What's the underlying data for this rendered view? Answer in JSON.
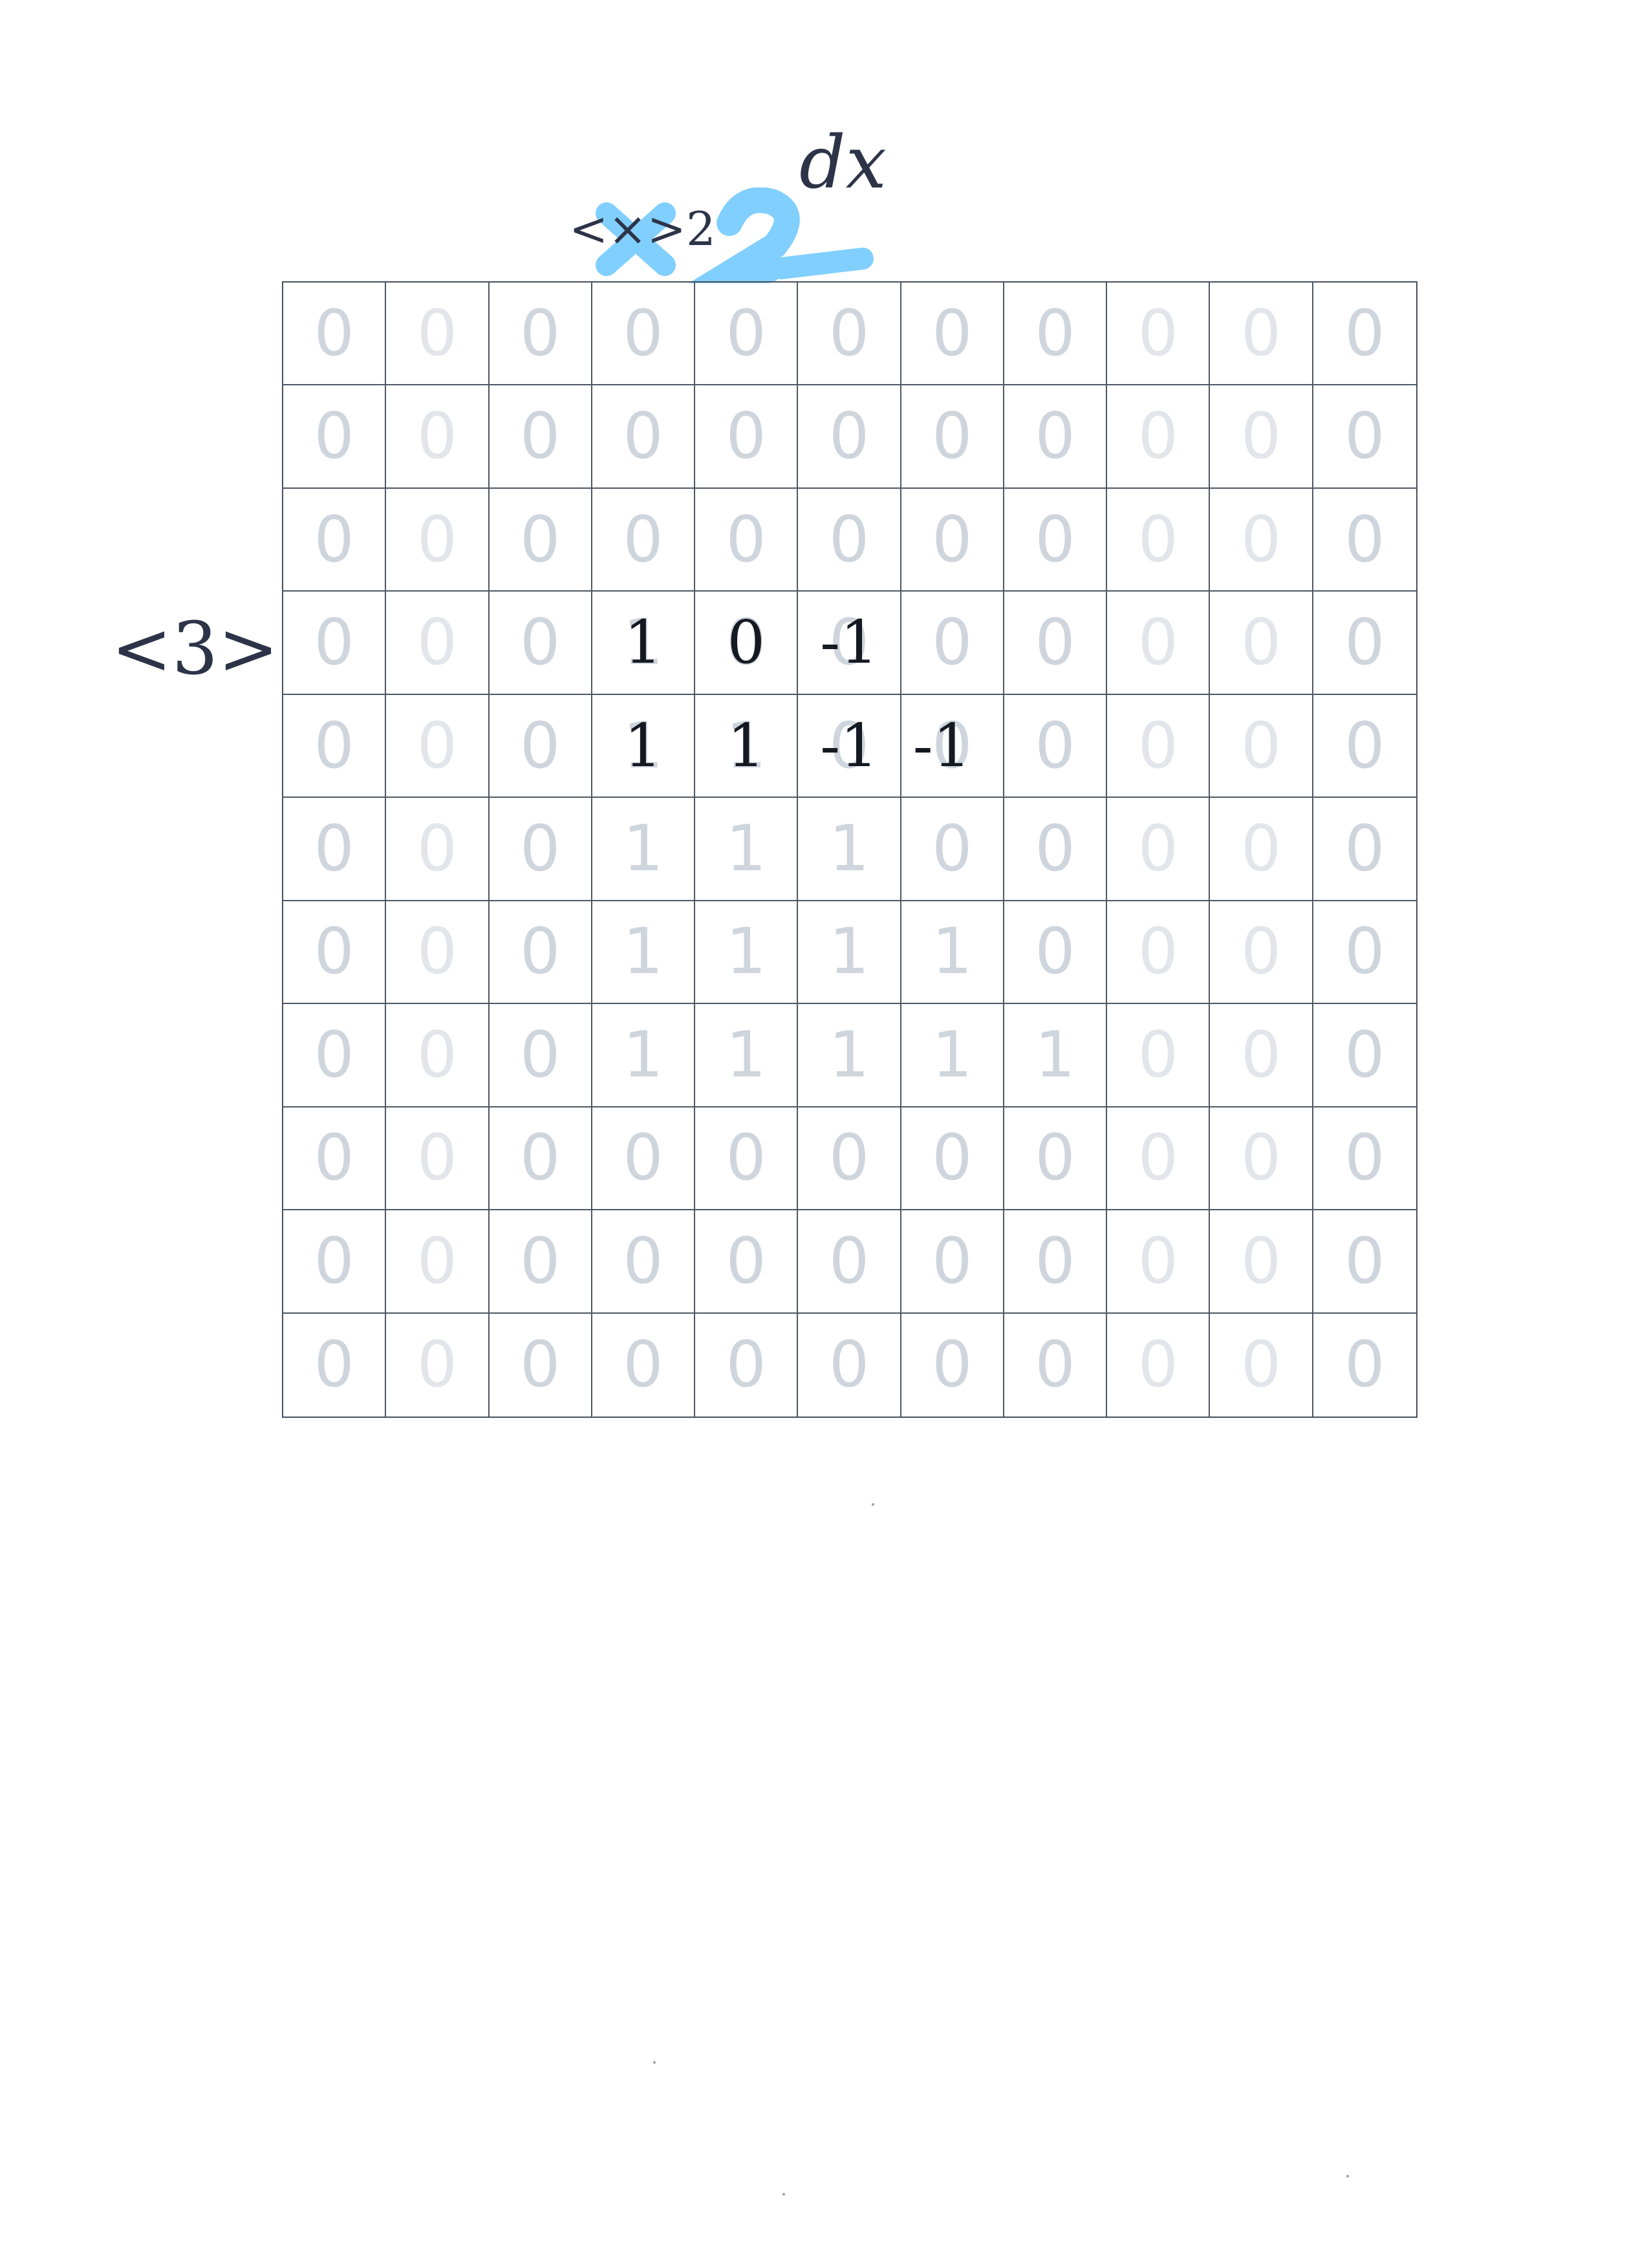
{
  "annotations": {
    "left_label": "<3>",
    "top_label": "<×>2",
    "dx_label": "dx"
  },
  "colors": {
    "grid_line": "#4d5865",
    "printed_digit": "#cfd5dc",
    "handwriting": "#151a22",
    "blue_highlight": "#80cfff",
    "pen_annotation": "#2d3448"
  },
  "grid": {
    "rows": [
      [
        "0",
        "0",
        "0",
        "0",
        "0",
        "0",
        "0",
        "0",
        "0",
        "0",
        "0"
      ],
      [
        "0",
        "0",
        "0",
        "0",
        "0",
        "0",
        "0",
        "0",
        "0",
        "0",
        "0"
      ],
      [
        "0",
        "0",
        "0",
        "0",
        "0",
        "0",
        "0",
        "0",
        "0",
        "0",
        "0"
      ],
      [
        "0",
        "0",
        "0",
        "1",
        "0",
        "0",
        "0",
        "0",
        "0",
        "0",
        "0"
      ],
      [
        "0",
        "0",
        "0",
        "1",
        "1",
        "0",
        "0",
        "0",
        "0",
        "0",
        "0"
      ],
      [
        "0",
        "0",
        "0",
        "1",
        "1",
        "1",
        "0",
        "0",
        "0",
        "0",
        "0"
      ],
      [
        "0",
        "0",
        "0",
        "1",
        "1",
        "1",
        "1",
        "0",
        "0",
        "0",
        "0"
      ],
      [
        "0",
        "0",
        "0",
        "1",
        "1",
        "1",
        "1",
        "1",
        "0",
        "0",
        "0"
      ],
      [
        "0",
        "0",
        "0",
        "0",
        "0",
        "0",
        "0",
        "0",
        "0",
        "0",
        "0"
      ],
      [
        "0",
        "0",
        "0",
        "0",
        "0",
        "0",
        "0",
        "0",
        "0",
        "0",
        "0"
      ],
      [
        "0",
        "0",
        "0",
        "0",
        "0",
        "0",
        "0",
        "0",
        "0",
        "0",
        "0"
      ]
    ],
    "handwritten": [
      {
        "row": 3,
        "col": 3,
        "text": "1"
      },
      {
        "row": 3,
        "col": 4,
        "text": "0"
      },
      {
        "row": 3,
        "col": 5,
        "text": "-1"
      },
      {
        "row": 4,
        "col": 3,
        "text": "1"
      },
      {
        "row": 4,
        "col": 4,
        "text": "1"
      },
      {
        "row": 4,
        "col": 5,
        "text": "-1"
      },
      {
        "row": 4,
        "col": 6,
        "text": "-1"
      }
    ]
  }
}
